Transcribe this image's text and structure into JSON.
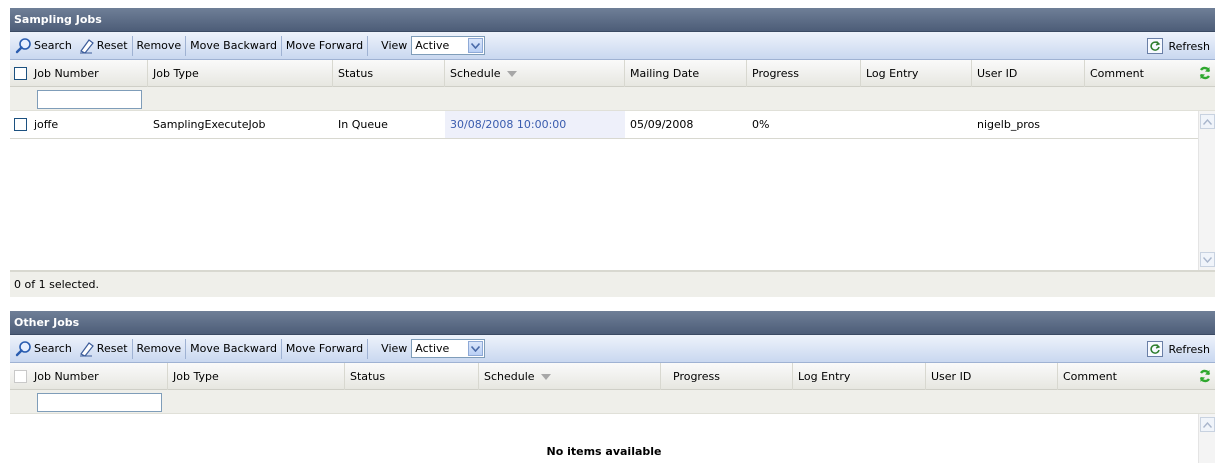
{
  "toolbar": {
    "search": "Search",
    "reset": "Reset",
    "remove": "Remove",
    "move_backward": "Move Backward",
    "move_forward": "Move Forward",
    "view_label": "View",
    "view_value": "Active",
    "refresh": "Refresh"
  },
  "sampling": {
    "title": "Sampling Jobs",
    "columns": [
      "Job Number",
      "Job Type",
      "Status",
      "Schedule",
      "Mailing Date",
      "Progress",
      "Log Entry",
      "User ID",
      "Comment"
    ],
    "rows": [
      {
        "job_number": "joffe",
        "job_type": "SamplingExecuteJob",
        "status": "In Queue",
        "schedule": "30/08/2008 10:00:00",
        "mailing_date": "05/09/2008",
        "progress": "0%",
        "log_entry": "",
        "user_id": "nigelb_pros",
        "comment": ""
      }
    ],
    "footer": "0 of 1 selected."
  },
  "other": {
    "title": "Other Jobs",
    "columns": [
      "Job Number",
      "Job Type",
      "Status",
      "Schedule",
      "Progress",
      "Log Entry",
      "User ID",
      "Comment"
    ],
    "empty_message": "No items available"
  },
  "colors": {
    "title_bar": "#5a6a85",
    "toolbar": "#c9d8f0",
    "schedule_link": "#3a5cae"
  },
  "icons": {
    "search": "magnifier-icon",
    "reset": "eraser-icon",
    "refresh": "refresh-icon",
    "grid_refresh": "green-refresh-icon"
  }
}
